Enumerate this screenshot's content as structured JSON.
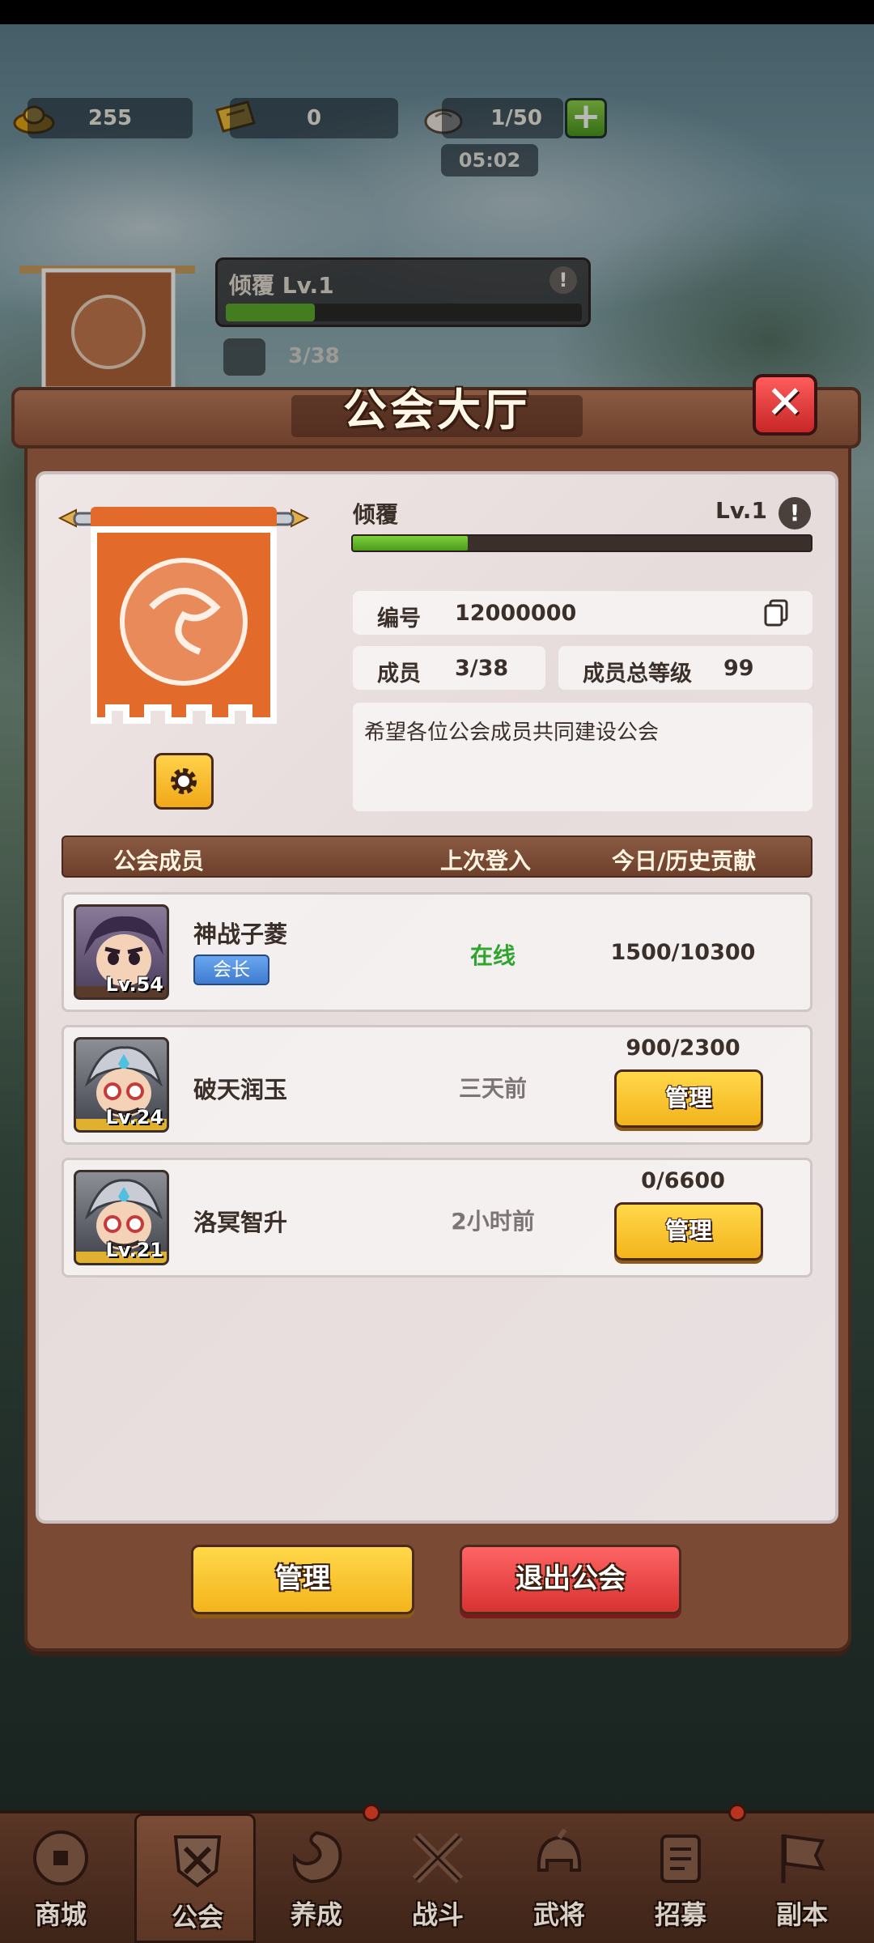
{
  "resources": [
    {
      "name": "gold-ingot",
      "value": "255"
    },
    {
      "name": "ticket",
      "value": "0"
    },
    {
      "name": "bun-stamina",
      "value": "1/50"
    }
  ],
  "timer": "05:02",
  "background_guild": {
    "name_level": "倾覆 Lv.1",
    "members": "3/38"
  },
  "panel": {
    "title": "公会大厅",
    "guild_name": "倾覆",
    "guild_level": "Lv.1",
    "xp_fraction": 0.25,
    "id_label": "编号",
    "id_value": "12000000",
    "members_label": "成员",
    "members_value": "3/38",
    "total_level_label": "成员总等级",
    "total_level_value": "99",
    "description": "希望各位公会成员共同建设公会"
  },
  "table": {
    "headers": [
      "公会成员",
      "上次登入",
      "今日/历史贡献"
    ],
    "rows": [
      {
        "name": "神战子菱",
        "level": "Lv.54",
        "role": "会长",
        "last_login": "在线",
        "online": true,
        "contribution": "1500/10300",
        "manage_label": ""
      },
      {
        "name": "破天润玉",
        "level": "Lv.24",
        "role": "",
        "last_login": "三天前",
        "online": false,
        "contribution": "900/2300",
        "manage_label": "管理"
      },
      {
        "name": "洛冥智升",
        "level": "Lv.21",
        "role": "",
        "last_login": "2小时前",
        "online": false,
        "contribution": "0/6600",
        "manage_label": "管理"
      }
    ]
  },
  "buttons": {
    "manage": "管理",
    "quit": "退出公会"
  },
  "nav": [
    {
      "label": "商城",
      "icon": "coin-icon"
    },
    {
      "label": "公会",
      "icon": "guild-shield-icon",
      "active": true
    },
    {
      "label": "养成",
      "icon": "dragon-icon"
    },
    {
      "label": "战斗",
      "icon": "crossed-swords-icon"
    },
    {
      "label": "武将",
      "icon": "helmet-icon"
    },
    {
      "label": "招募",
      "icon": "recruit-scroll-icon"
    },
    {
      "label": "副本",
      "icon": "dungeon-flag-icon"
    }
  ],
  "colors": {
    "online": "#2fa52f",
    "offline": "#7d7474",
    "accent_yellow": "#f3b41c",
    "accent_red": "#d83232",
    "panel_brown": "#7a4a35"
  }
}
